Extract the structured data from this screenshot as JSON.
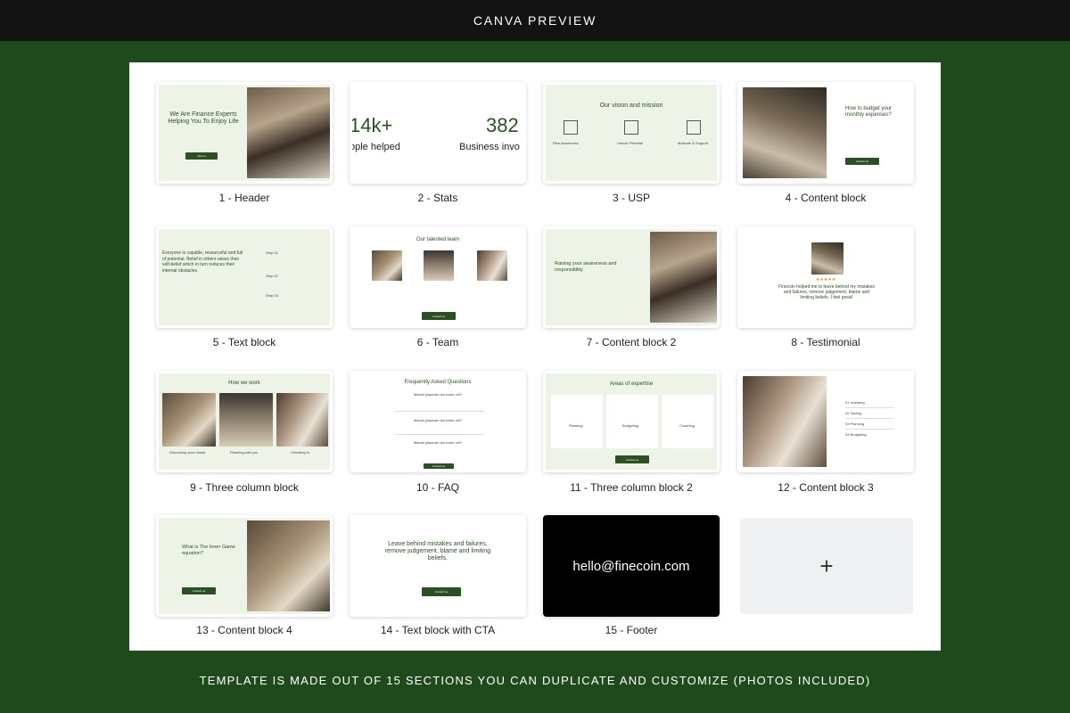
{
  "header": {
    "title": "CANVA PREVIEW"
  },
  "sections": [
    {
      "label": "1 - Header"
    },
    {
      "label": "2 - Stats"
    },
    {
      "label": "3 - USP"
    },
    {
      "label": "4 - Content block"
    },
    {
      "label": "5 - Text block"
    },
    {
      "label": "6 - Team"
    },
    {
      "label": "7 - Content block 2"
    },
    {
      "label": "8 - Testimonial"
    },
    {
      "label": "9 - Three column block"
    },
    {
      "label": "10 - FAQ"
    },
    {
      "label": "11 - Three column block 2"
    },
    {
      "label": "12 - Content block 3"
    },
    {
      "label": "13 - Content block 4"
    },
    {
      "label": "14 - Text block with CTA"
    },
    {
      "label": "15 - Footer"
    }
  ],
  "thumbs": {
    "header": {
      "title": "We Are Finance Experts Helping You To Enjoy Life",
      "button": "Join us"
    },
    "stats": {
      "value1": "14k+",
      "label1": "ople helped",
      "value2": "382",
      "label2": "Business invo"
    },
    "usp": {
      "title": "Our vision and mission",
      "cols": [
        "Rise Awareness",
        "Unlock Potential",
        "Motivate & Support"
      ]
    },
    "content1": {
      "title": "How to budget your monthly expenses?",
      "button": "Contact us"
    },
    "textblock": {
      "body": "Everyone is capable, resourceful and full of potential. Belief in others raises their self-belief which in turn reduces their internal obstacles.",
      "steps": [
        "Step 01",
        "Step 02",
        "Step 03"
      ]
    },
    "team": {
      "title": "Our talented team",
      "button": "Contact us"
    },
    "content2": {
      "title": "Raising your awareness and responsibility"
    },
    "testimonial": {
      "stars": "★★★★★",
      "quote": "Finecoin helped me to leave behind my mistakes and failures, remove judgement, blame and limiting beliefs. I feel great!"
    },
    "howwework": {
      "title": "How we work",
      "cols": [
        "Discussing your needs",
        "Planning with you",
        "Checking in"
      ]
    },
    "faq": {
      "title": "Frequently Asked Questions",
      "questions": [
        "Mauris placerat non tortor vel?",
        "Mauris placerat non tortor vel?",
        "Mauris placerat non tortor vel?"
      ],
      "button": "Contact us"
    },
    "expertise": {
      "title": "Areas of expertise",
      "cols": [
        "Planning",
        "Budgeting",
        "Coaching"
      ],
      "button": "Contact us"
    },
    "content3": {
      "items": [
        "01 Investing",
        "02 Saving",
        "03 Planning",
        "04 Budgeting"
      ]
    },
    "content4": {
      "title": "What is The Inner Game equation?",
      "button": "Contact us"
    },
    "cta": {
      "title": "Leave behind mistakes and failures, remove judgement, blame and limiting beliefs.",
      "button": "Contact us"
    },
    "footer": {
      "email": "hello@finecoin.com"
    },
    "add": {
      "symbol": "+"
    }
  },
  "bottom_text": "TEMPLATE IS MADE OUT OF 15 SECTIONS YOU CAN DUPLICATE AND CUSTOMIZE (PHOTOS INCLUDED)"
}
